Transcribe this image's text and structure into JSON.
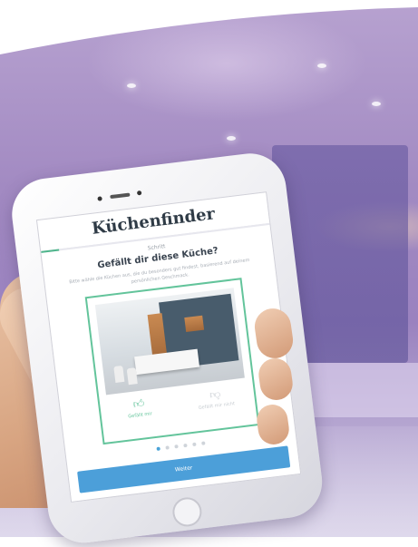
{
  "app": {
    "title": "Küchenfinder",
    "progress": 0.08
  },
  "step": {
    "label": "Schritt",
    "question": "Gefällt dir diese Küche?",
    "subtext": "Bitte wähle die Küchen aus, die du besonders gut findest, basierend auf deinem persönlichen Geschmack."
  },
  "choices": {
    "like_label": "Gefällt mir",
    "dislike_label": "Gefällt mir nicht",
    "like_icon": "thumbs-up-icon",
    "dislike_icon": "thumbs-down-icon"
  },
  "pagination": {
    "total": 6,
    "active_index": 0
  },
  "footer": {
    "next_label": "Weiter"
  },
  "colors": {
    "accent_green": "#63c49b",
    "button_blue": "#4c9fd9",
    "background_purple": "#a28ac2"
  }
}
